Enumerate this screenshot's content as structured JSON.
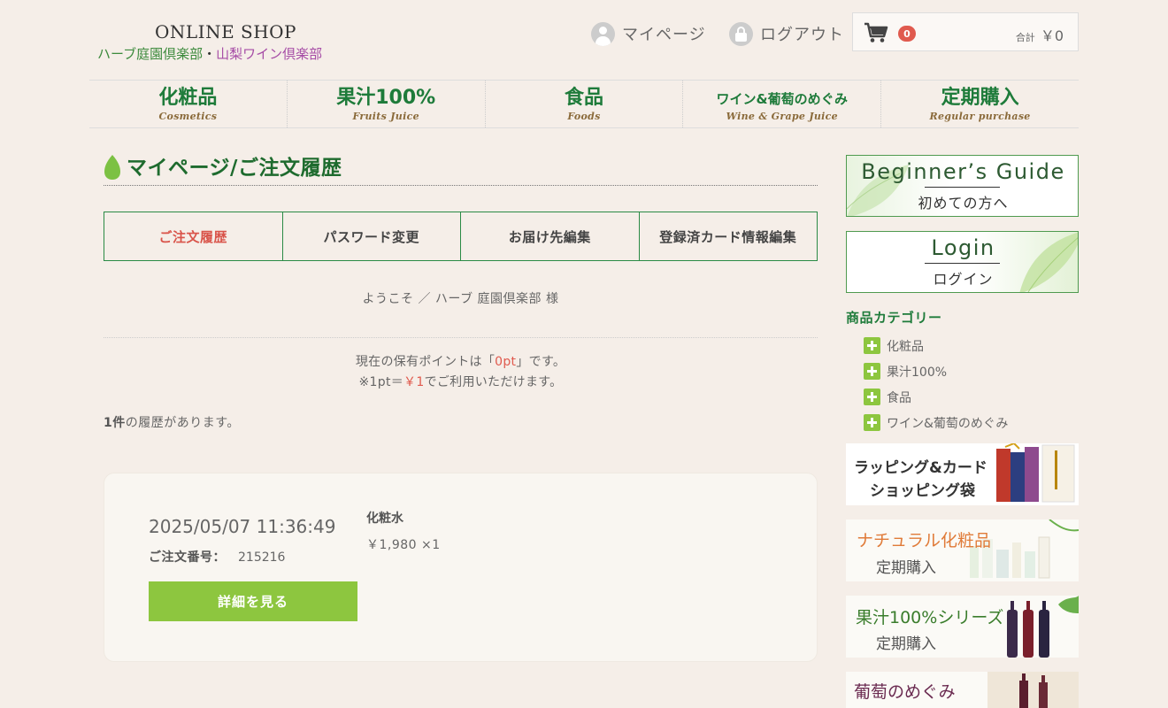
{
  "header": {
    "logo_top": "ONLINE SHOP",
    "logo_left": "ハーブ庭園倶楽部",
    "logo_sep": "・",
    "logo_right": "山梨ワイン倶楽部",
    "mypage_label": "マイページ",
    "logout_label": "ログアウト",
    "cart_count": "0",
    "cart_total_label": "合計",
    "cart_total": "￥0"
  },
  "nav": [
    {
      "jp": "化粧品",
      "en": "Cosmetics"
    },
    {
      "jp": "果汁100%",
      "en": "Fruits Juice"
    },
    {
      "jp": "食品",
      "en": "Foods"
    },
    {
      "jp": "ワイン&葡萄のめぐみ",
      "en": "Wine & Grape Juice"
    },
    {
      "jp": "定期購入",
      "en": "Regular purchase"
    }
  ],
  "page": {
    "title": "マイページ/ご注文履歴",
    "tabs": [
      "ご注文履歴",
      "パスワード変更",
      "お届け先編集",
      "登録済カード情報編集"
    ],
    "welcome": "ようこそ ／ ハーブ 庭園倶楽部 様",
    "points_pre": "現在の保有ポイントは「",
    "points_value": "0pt",
    "points_post": "」です。",
    "rate_pre": "※1pt＝",
    "rate_value": "￥1",
    "rate_post": "でご利用いただけます。",
    "count_value": "1件",
    "count_text": "の履歴があります。"
  },
  "order": {
    "date": "2025/05/07 11:36:49",
    "number_label": "ご注文番号：",
    "number": "215216",
    "button_label": "詳細を見る",
    "item_name": "化粧水",
    "item_price": "￥1,980 ×1"
  },
  "sidebar": {
    "guide_title": "Beginner’s Guide",
    "guide_sub": "初めての方へ",
    "login_title": "Login",
    "login_sub": "ログイン",
    "category_title": "商品カテゴリー",
    "categories": [
      "化粧品",
      "果汁100%",
      "食品",
      "ワイン&葡萄のめぐみ"
    ],
    "promo_wrapping_1": "ラッピング&カード",
    "promo_wrapping_2": "ショッピング袋",
    "promo_natural_1": "ナチュラル化粧品",
    "promo_natural_2": "定期購入",
    "promo_juice_1": "果汁100%シリーズ",
    "promo_juice_2": "定期購入",
    "promo_grape_1": "葡萄のめぐみ"
  },
  "colors": {
    "brand_green": "#1e7b3a",
    "accent_red": "#e05a4e",
    "button_green": "#8dc63f"
  }
}
